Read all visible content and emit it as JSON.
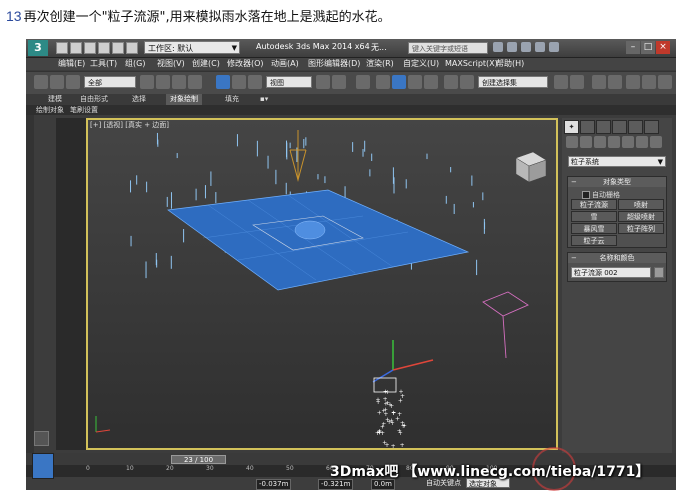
{
  "caption": {
    "step": "13",
    "text": "再次创建一个\"粒子流源\",用来模拟雨水落在地上是溅起的水花。"
  },
  "titlebar": {
    "logo": "3",
    "workspace": "工作区: 默认",
    "app_title": "Autodesk 3ds Max  2014 x64",
    "doc_title": "无...",
    "search_placeholder": "键入关键字或短语"
  },
  "menu": [
    "编辑(E)",
    "工具(T)",
    "组(G)",
    "视图(V)",
    "创建(C)",
    "修改器(O)",
    "动画(A)",
    "图形编辑器(D)",
    "渲染(R)",
    "自定义(U)",
    "MAXScript(X)",
    "帮助(H)"
  ],
  "toolbar": {
    "selection_filter": "全部",
    "ref_coord": "视图",
    "named_selection": "创建选择集"
  },
  "ribbon": {
    "tabs": [
      "建模",
      "自由形式",
      "选择",
      "对象绘制",
      "填充"
    ],
    "active": "对象绘制",
    "subtabs": [
      "绘制对象",
      "笔刷设置"
    ]
  },
  "viewport": {
    "label": "[+] [透视] [真实 + 边面]",
    "border_color": "#d2c15a"
  },
  "command_panel": {
    "category": "粒子系统",
    "object_type_title": "对象类型",
    "auto_grid": "自动栅格",
    "buttons": [
      "粒子流源",
      "喷射",
      "雪",
      "超级喷射",
      "暴风雪",
      "粒子阵列",
      "粒子云"
    ],
    "name_title": "名称和颜色",
    "name_value": "粒子流源 002"
  },
  "timeline": {
    "slider": "23 / 100",
    "ticks": [
      "0",
      "10",
      "20",
      "30",
      "40",
      "50",
      "60",
      "70",
      "80",
      "90",
      "100"
    ]
  },
  "status": {
    "x_value": "-0.037m",
    "y_value": "-0.321m",
    "z_value": "0.0m",
    "autokey": "自动关键点",
    "selected": "选定对象"
  },
  "watermark": "3Dmax吧 【www.linecg.com/tieba/1771】",
  "colors": {
    "ground": "#2e6cc0",
    "emitter": "#c8922c",
    "camera": "#d56fc0"
  }
}
